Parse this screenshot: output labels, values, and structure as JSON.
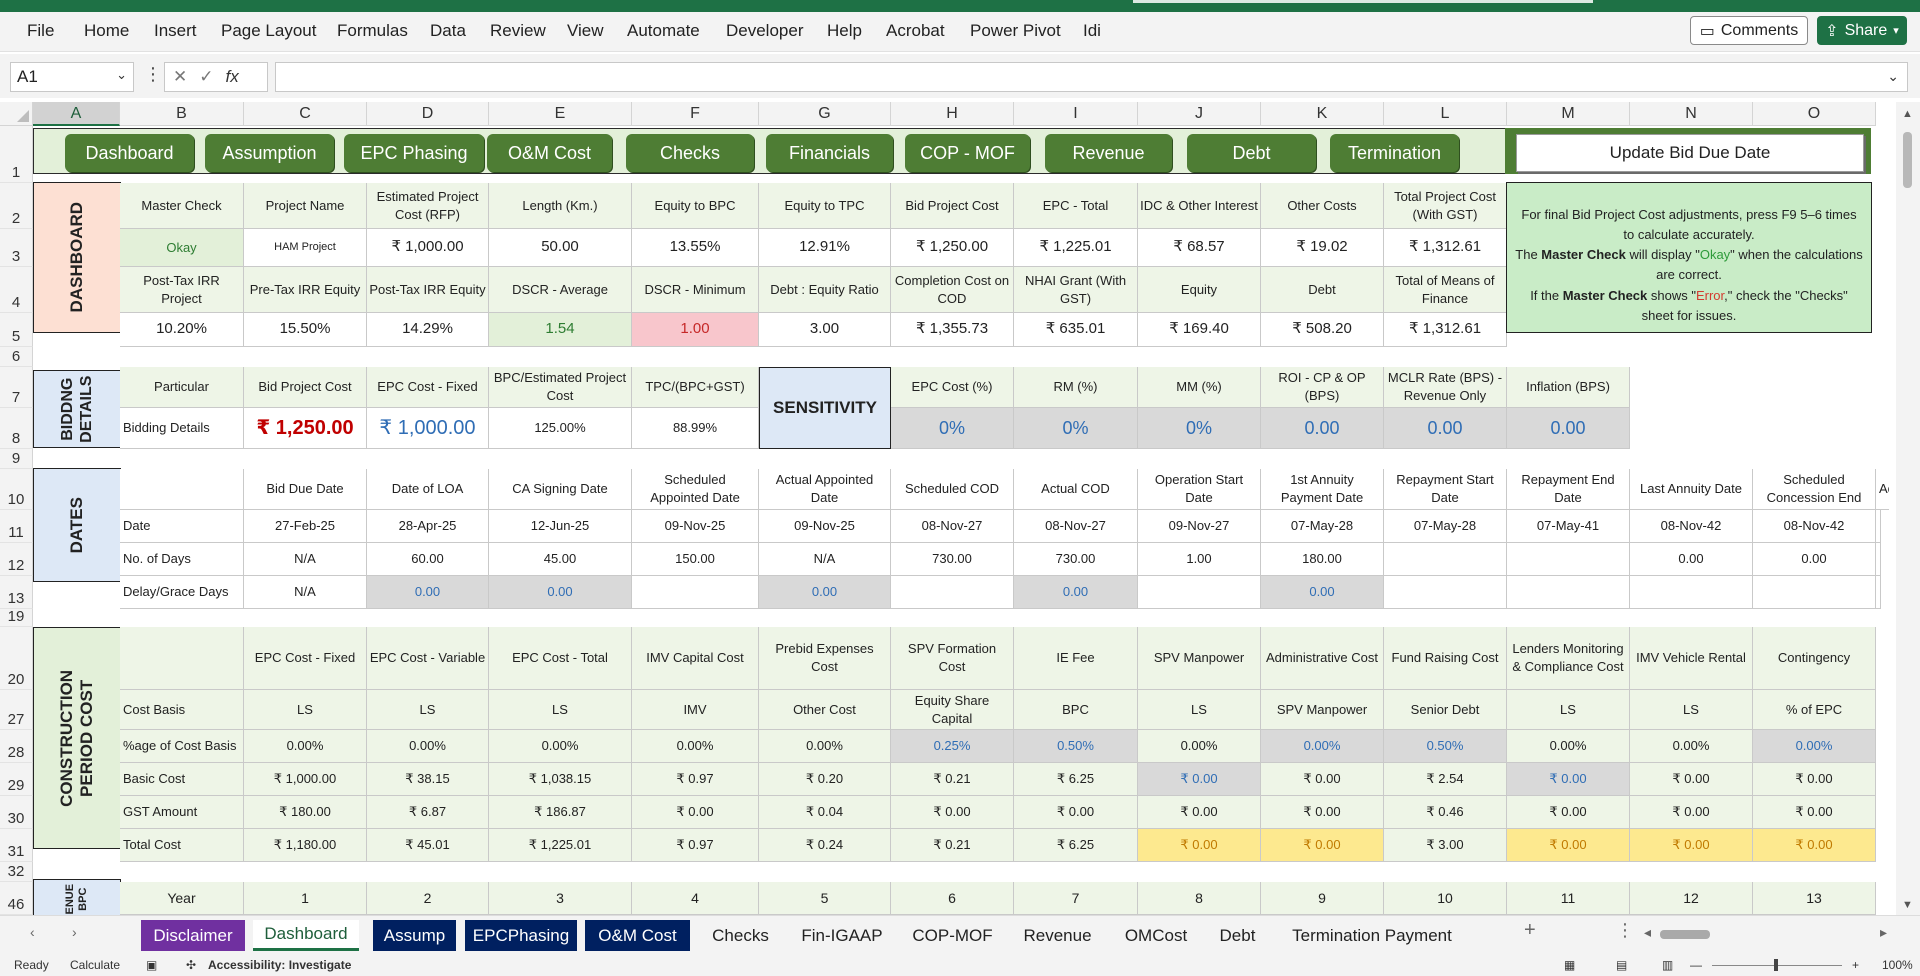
{
  "ribbon": {
    "menus": [
      "File",
      "Home",
      "Insert",
      "Page Layout",
      "Formulas",
      "Data",
      "Review",
      "View",
      "Automate",
      "Developer",
      "Help",
      "Acrobat",
      "Power Pivot",
      "Idi"
    ],
    "comments": "Comments",
    "share": "Share"
  },
  "formula_bar": {
    "name_box": "A1",
    "fx": "fx",
    "content": ""
  },
  "columns": [
    "A",
    "B",
    "C",
    "D",
    "E",
    "F",
    "G",
    "H",
    "I",
    "J",
    "K",
    "L",
    "M",
    "N",
    "O"
  ],
  "rows": [
    "1",
    "2",
    "3",
    "4",
    "5",
    "6",
    "7",
    "8",
    "9",
    "10",
    "11",
    "12",
    "13",
    "19",
    "20",
    "27",
    "28",
    "29",
    "30",
    "31",
    "32",
    "46"
  ],
  "nav_buttons": [
    "Dashboard",
    "Assumption",
    "EPC Phasing",
    "O&M Cost",
    "Checks",
    "Financials",
    "COP - MOF",
    "Revenue",
    "Debt",
    "Termination"
  ],
  "update_button": "Update Bid Due Date",
  "dashboard": {
    "section_label": "DASHBOARD",
    "header1": [
      "Master Check",
      "Project Name",
      "Estimated Project Cost (RFP)",
      "Length (Km.)",
      "Equity to BPC",
      "Equity to TPC",
      "Bid Project Cost",
      "EPC - Total",
      "IDC & Other Interest",
      "Other Costs",
      "Total Project Cost (With GST)"
    ],
    "values1": [
      "Okay",
      "HAM Project",
      "₹ 1,000.00",
      "50.00",
      "13.55%",
      "12.91%",
      "₹ 1,250.00",
      "₹ 1,225.01",
      "₹ 68.57",
      "₹ 19.02",
      "₹ 1,312.61"
    ],
    "header2": [
      "Post-Tax IRR Project",
      "Pre-Tax IRR Equity",
      "Post-Tax IRR Equity",
      "DSCR - Average",
      "DSCR - Minimum",
      "Debt : Equity Ratio",
      "Completion Cost on COD",
      "NHAI Grant (With GST)",
      "Equity",
      "Debt",
      "Total of Means of Finance"
    ],
    "values2": [
      "10.20%",
      "15.50%",
      "14.29%",
      "1.54",
      "1.00",
      "3.00",
      "₹ 1,355.73",
      "₹ 635.01",
      "₹ 169.40",
      "₹ 508.20",
      "₹ 1,312.61"
    ],
    "note": {
      "line1": "For final Bid Project Cost adjustments, press F9 5–6 times to calculate accurately.",
      "line2_pre": "The ",
      "line2_bold": "Master Check",
      "line2_mid": " will display \"",
      "line2_ok": "Okay",
      "line2_post": "\" when the calculations are correct.",
      "line3_pre": "If the ",
      "line3_bold": "Master Check",
      "line3_mid": " shows \"",
      "line3_err": "Error",
      "line3_post": ",\" check the \"Checks\" sheet for issues."
    }
  },
  "bidding": {
    "section_label": "BIDDNG DETAILS",
    "headers": [
      "Particular",
      "Bid Project Cost",
      "EPC Cost - Fixed",
      "BPC/Estimated Project Cost",
      "TPC/(BPC+GST)"
    ],
    "values": [
      "Bidding Details",
      "₹ 1,250.00",
      "₹ 1,000.00",
      "125.00%",
      "88.99%"
    ],
    "sensitivity_label": "SENSITIVITY",
    "sens_headers": [
      "EPC Cost (%)",
      "RM (%)",
      "MM (%)",
      "ROI - CP & OP (BPS)",
      "MCLR Rate (BPS) - Revenue Only",
      "Inflation (BPS)"
    ],
    "sens_values": [
      "0%",
      "0%",
      "0%",
      "0.00",
      "0.00",
      "0.00"
    ]
  },
  "dates": {
    "section_label": "DATES",
    "headers": [
      "Bid Due Date",
      "Date of LOA",
      "CA Signing Date",
      "Scheduled Appointed Date",
      "Actual Appointed Date",
      "Scheduled COD",
      "Actual COD",
      "Operation Start Date",
      "1st Annuity Payment Date",
      "Repayment Start Date",
      "Repayment End Date",
      "Last Annuity Date",
      "Scheduled Concession End",
      "Ac"
    ],
    "row_labels": [
      "Date",
      "No. of Days",
      "Delay/Grace Days"
    ],
    "date_row": [
      "27-Feb-25",
      "28-Apr-25",
      "12-Jun-25",
      "09-Nov-25",
      "09-Nov-25",
      "08-Nov-27",
      "08-Nov-27",
      "09-Nov-27",
      "07-May-28",
      "07-May-28",
      "07-May-41",
      "08-Nov-42",
      "08-Nov-42",
      ""
    ],
    "days_row": [
      "N/A",
      "60.00",
      "45.00",
      "150.00",
      "N/A",
      "730.00",
      "730.00",
      "1.00",
      "180.00",
      "",
      "",
      "0.00",
      "0.00",
      ""
    ],
    "delay_row": [
      "N/A",
      "0.00",
      "0.00",
      "",
      "0.00",
      "",
      "0.00",
      "",
      "0.00",
      "",
      "",
      "",
      "",
      ""
    ]
  },
  "construction": {
    "section_label": "CONSTRUCTION PERIOD COST",
    "headers": [
      "EPC Cost - Fixed",
      "EPC Cost - Variable",
      "EPC Cost - Total",
      "IMV Capital Cost",
      "Prebid Expenses Cost",
      "SPV Formation Cost",
      "IE Fee",
      "SPV Manpower",
      "Administrative Cost",
      "Fund Raising Cost",
      "Lenders Monitoring & Compliance Cost",
      "IMV Vehicle Rental",
      "Contingency"
    ],
    "row_labels": [
      "Cost Basis",
      "%age of Cost Basis",
      "Basic Cost",
      "GST Amount",
      "Total Cost"
    ],
    "cost_basis": [
      "LS",
      "LS",
      "LS",
      "IMV",
      "Other Cost",
      "Equity Share Capital",
      "BPC",
      "LS",
      "SPV Manpower",
      "Senior Debt",
      "LS",
      "LS",
      "% of EPC"
    ],
    "pct": [
      "0.00%",
      "0.00%",
      "0.00%",
      "0.00%",
      "0.00%",
      "0.25%",
      "0.50%",
      "0.00%",
      "0.00%",
      "0.50%",
      "0.00%",
      "0.00%",
      "0.00%"
    ],
    "basic": [
      "₹ 1,000.00",
      "₹ 38.15",
      "₹ 1,038.15",
      "₹ 0.97",
      "₹ 0.20",
      "₹ 0.21",
      "₹ 6.25",
      "₹ 0.00",
      "₹ 0.00",
      "₹ 2.54",
      "₹ 0.00",
      "₹ 0.00",
      "₹ 0.00"
    ],
    "gst": [
      "₹ 180.00",
      "₹ 6.87",
      "₹ 186.87",
      "₹ 0.00",
      "₹ 0.04",
      "₹ 0.00",
      "₹ 0.00",
      "₹ 0.00",
      "₹ 0.00",
      "₹ 0.46",
      "₹ 0.00",
      "₹ 0.00",
      "₹ 0.00"
    ],
    "total": [
      "₹ 1,180.00",
      "₹ 45.01",
      "₹ 1,225.01",
      "₹ 0.97",
      "₹ 0.24",
      "₹ 0.21",
      "₹ 6.25",
      "₹ 0.00",
      "₹ 0.00",
      "₹ 3.00",
      "₹ 0.00",
      "₹ 0.00",
      "₹ 0.00"
    ]
  },
  "revenue": {
    "section_label": "ENUE BPC",
    "year_label": "Year",
    "years": [
      "1",
      "2",
      "3",
      "4",
      "5",
      "6",
      "7",
      "8",
      "9",
      "10",
      "11",
      "12",
      "13"
    ]
  },
  "tabs": [
    "Disclaimer",
    "Dashboard",
    "Assump",
    "EPCPhasing",
    "O&M Cost",
    "Checks",
    "Fin-IGAAP",
    "COP-MOF",
    "Revenue",
    "OMCost",
    "Debt",
    "Termination Payment"
  ],
  "status": {
    "ready": "Ready",
    "calculate": "Calculate",
    "accessibility": "Accessibility: Investigate",
    "zoom": "100%"
  },
  "colors": {
    "excel_green": "#1e7145",
    "nav_button": "#4e7d34",
    "section_fill": "#eef5e7"
  }
}
